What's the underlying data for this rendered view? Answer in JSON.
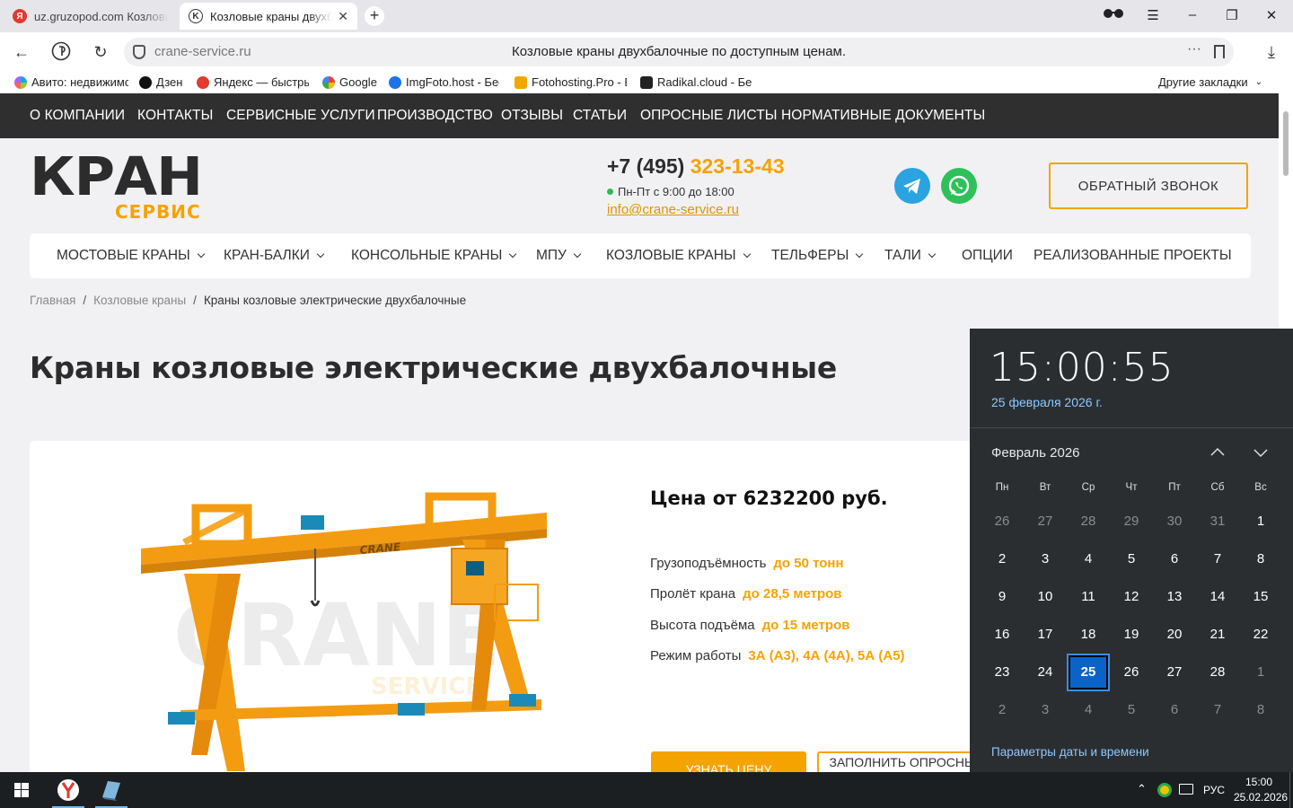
{
  "browser": {
    "tabs": [
      {
        "title": "uz.gruzopod.com Козловые краны",
        "active": false
      },
      {
        "title": "Козловые краны двухбалочные",
        "active": true
      }
    ],
    "new_tab": "+",
    "address": {
      "host": "crane-service.ru",
      "page_title": "Козловые краны двухбалочные по доступным ценам."
    },
    "bookmarks": [
      {
        "label": "Авито: недвижимость"
      },
      {
        "label": "Дзен"
      },
      {
        "label": "Яндекс — быстрый поиск"
      },
      {
        "label": "Google"
      },
      {
        "label": "ImgFoto.host - Бесплатный"
      },
      {
        "label": "Fotohosting.Pro - Бесплатный"
      },
      {
        "label": "Radikal.cloud - Бесплатный"
      }
    ],
    "other_bookmarks": "Другие закладки"
  },
  "site": {
    "topnav": [
      "О КОМПАНИИ",
      "КОНТАКТЫ",
      "СЕРВИСНЫЕ УСЛУГИ",
      "ПРОИЗВОДСТВО",
      "ОТЗЫВЫ",
      "СТАТЬИ",
      "ОПРОСНЫЕ ЛИСТЫ",
      "НОРМАТИВНЫЕ ДОКУМЕНТЫ"
    ],
    "logo": {
      "main": "КРАН",
      "sub": "СЕРВИС"
    },
    "phone": {
      "prefix": "+7 (495) ",
      "number": "323-13-43"
    },
    "hours": "Пн-Пт с 9:00 до 18:00",
    "email": "info@crane-service.ru",
    "callback": "ОБРАТНЫЙ ЗВОНОК",
    "mainnav": [
      "МОСТОВЫЕ КРАНЫ",
      "КРАН-БАЛКИ",
      "КОНСОЛЬНЫЕ КРАНЫ",
      "МПУ",
      "КОЗЛОВЫЕ КРАНЫ",
      "ТЕЛЬФЕРЫ",
      "ТАЛИ",
      "ОПЦИИ",
      "РЕАЛИЗОВАННЫЕ ПРОЕКТЫ"
    ],
    "breadcrumbs": [
      "Главная",
      "Козловые краны",
      "Краны козловые электрические двухбалочные"
    ],
    "title": "Краны козловые электрические двухбалочные",
    "product": {
      "image_label": "CRANE",
      "watermark": "CRANE",
      "watermark_sub": "SERVICE",
      "price": "Цена от 6232200 руб.",
      "specs": [
        {
          "label": "Грузоподъёмность",
          "value": "до 50 тонн"
        },
        {
          "label": "Пролёт крана",
          "value": "до 28,5 метров"
        },
        {
          "label": "Высота подъёма",
          "value": "до 15 метров"
        },
        {
          "label": "Режим работы",
          "value": "3А (А3), 4А (4А), 5А (А5)"
        }
      ],
      "btn_price": "УЗНАТЬ ЦЕНУ",
      "btn_fill": "ЗАПОЛНИТЬ ОПРОСНЫЙ ЛИСТ"
    }
  },
  "clock": {
    "time": "15:00:55",
    "date": "25 февраля 2026 г.",
    "month": "Февраль 2026",
    "weekdays": [
      "Пн",
      "Вт",
      "Ср",
      "Чт",
      "Пт",
      "Сб",
      "Вс"
    ],
    "weeks": [
      [
        "26",
        "27",
        "28",
        "29",
        "30",
        "31",
        "1"
      ],
      [
        "2",
        "3",
        "4",
        "5",
        "6",
        "7",
        "8"
      ],
      [
        "9",
        "10",
        "11",
        "12",
        "13",
        "14",
        "15"
      ],
      [
        "16",
        "17",
        "18",
        "19",
        "20",
        "21",
        "22"
      ],
      [
        "23",
        "24",
        "25",
        "26",
        "27",
        "28",
        "1"
      ],
      [
        "2",
        "3",
        "4",
        "5",
        "6",
        "7",
        "8"
      ]
    ],
    "today": "25",
    "settings": "Параметры даты и времени"
  },
  "taskbar": {
    "lang": "РУС",
    "time": "15:00",
    "date": "25.02.2026"
  },
  "colors": {
    "accent": "#f5a300",
    "dark": "#2f2f2f",
    "clock_bg": "#2b2e31",
    "today": "#0a64c8"
  }
}
